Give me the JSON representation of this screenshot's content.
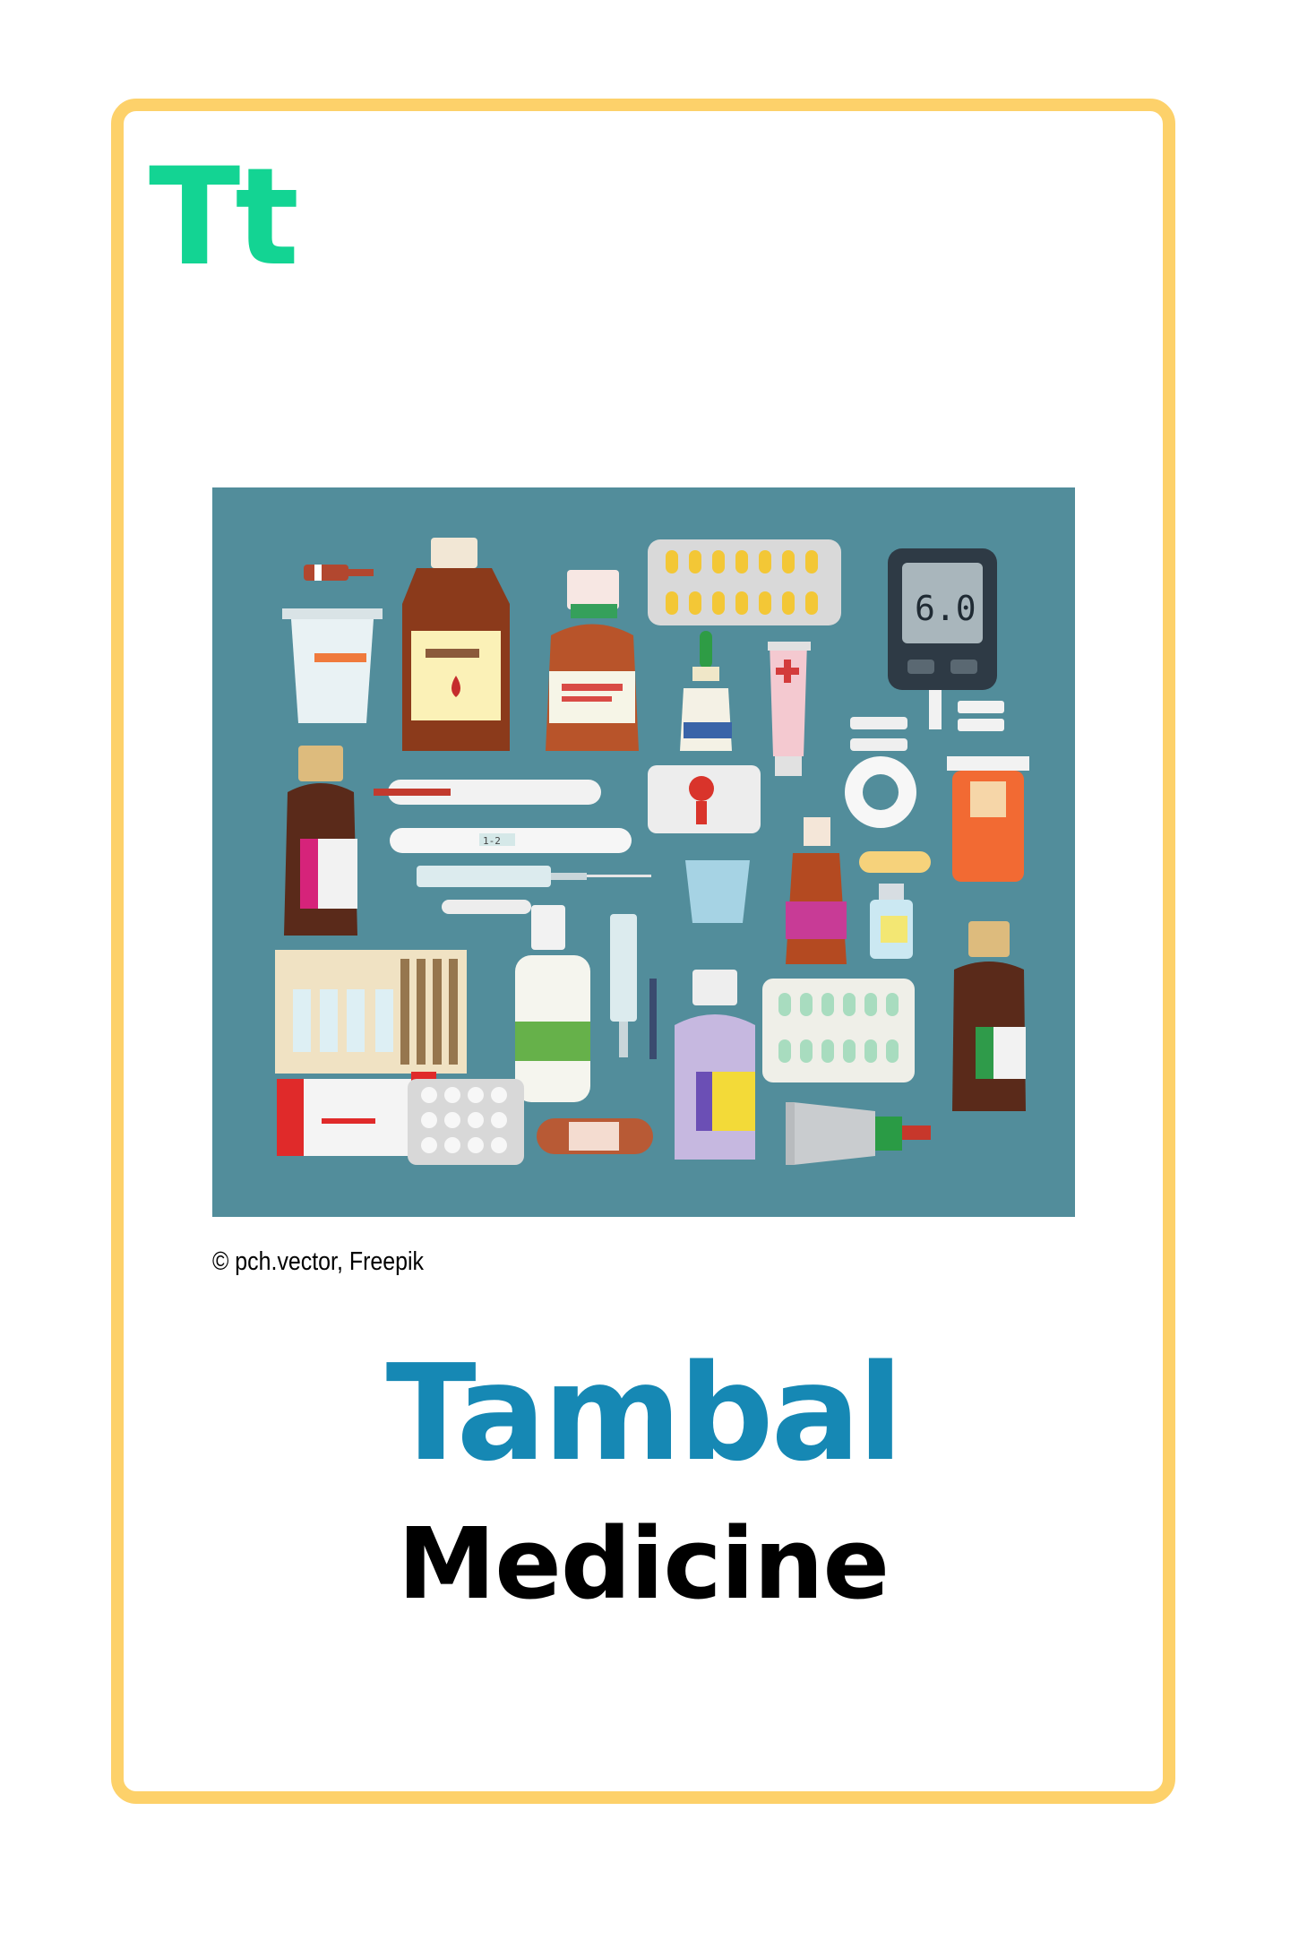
{
  "card": {
    "letters": "Tt",
    "credit": "© pch.vector, Freepik",
    "word_malay": "Tambal",
    "word_english": "Medicine",
    "meter_reading": "6.0",
    "thermometer_label": "1-2"
  },
  "colors": {
    "border": "#FDD16A",
    "letters": "#13D493",
    "word_malay": "#1688B4",
    "word_english": "#000000",
    "illustration_bg": "#528D9B"
  }
}
